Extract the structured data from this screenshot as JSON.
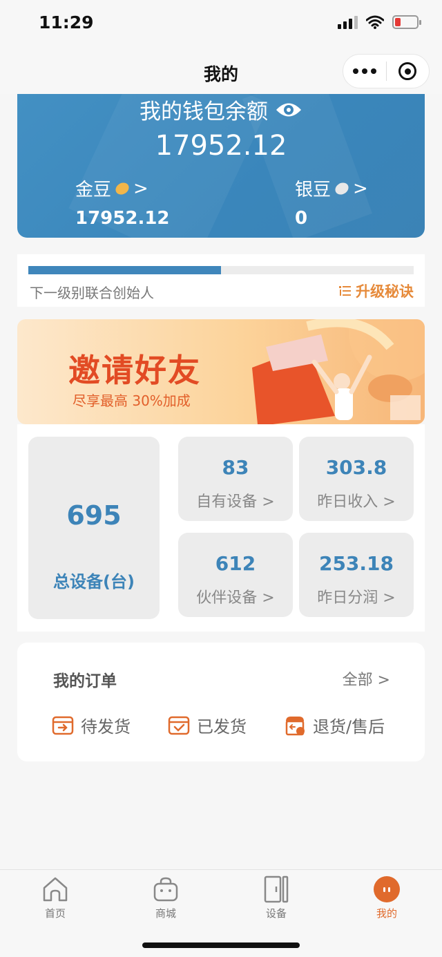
{
  "status_bar": {
    "time": "11:29"
  },
  "nav": {
    "title": "我的"
  },
  "wallet": {
    "title": "我的钱包余额",
    "total": "17952.12",
    "gold": {
      "label": "金豆",
      "value": "17952.12"
    },
    "silver": {
      "label": "银豆",
      "value": "0"
    }
  },
  "level": {
    "progress": 0.5,
    "text": "下一级别联合创始人",
    "upgrade_label": "升级秘诀"
  },
  "banner": {
    "title": "邀请好友",
    "subtitle": "尽享最高  30%加成"
  },
  "stats": {
    "total_devices": {
      "value": "695",
      "label": "总设备(台)"
    },
    "own_devices": {
      "value": "83",
      "label": "自有设备 >"
    },
    "yesterday_income": {
      "value": "303.8",
      "label": "昨日收入 >"
    },
    "partner_devices": {
      "value": "612",
      "label": "伙伴设备 >"
    },
    "yesterday_profit": {
      "value": "253.18",
      "label": "昨日分润 >"
    }
  },
  "orders": {
    "title": "我的订单",
    "all_label": "全部 >",
    "items": [
      {
        "label": "待发货",
        "icon": "pending-shipment-icon"
      },
      {
        "label": "已发货",
        "icon": "shipped-icon"
      },
      {
        "label": "退货/售后",
        "icon": "return-icon"
      }
    ]
  },
  "tab_bar": {
    "items": [
      {
        "label": "首页",
        "icon": "home-icon"
      },
      {
        "label": "商城",
        "icon": "shop-bag-icon"
      },
      {
        "label": "设备",
        "icon": "device-icon"
      },
      {
        "label": "我的",
        "icon": "profile-icon",
        "active": true
      }
    ]
  },
  "colors": {
    "accent_blue": "#3d84b8",
    "accent_orange": "#e06a2c",
    "banner_red": "#e24b24"
  }
}
